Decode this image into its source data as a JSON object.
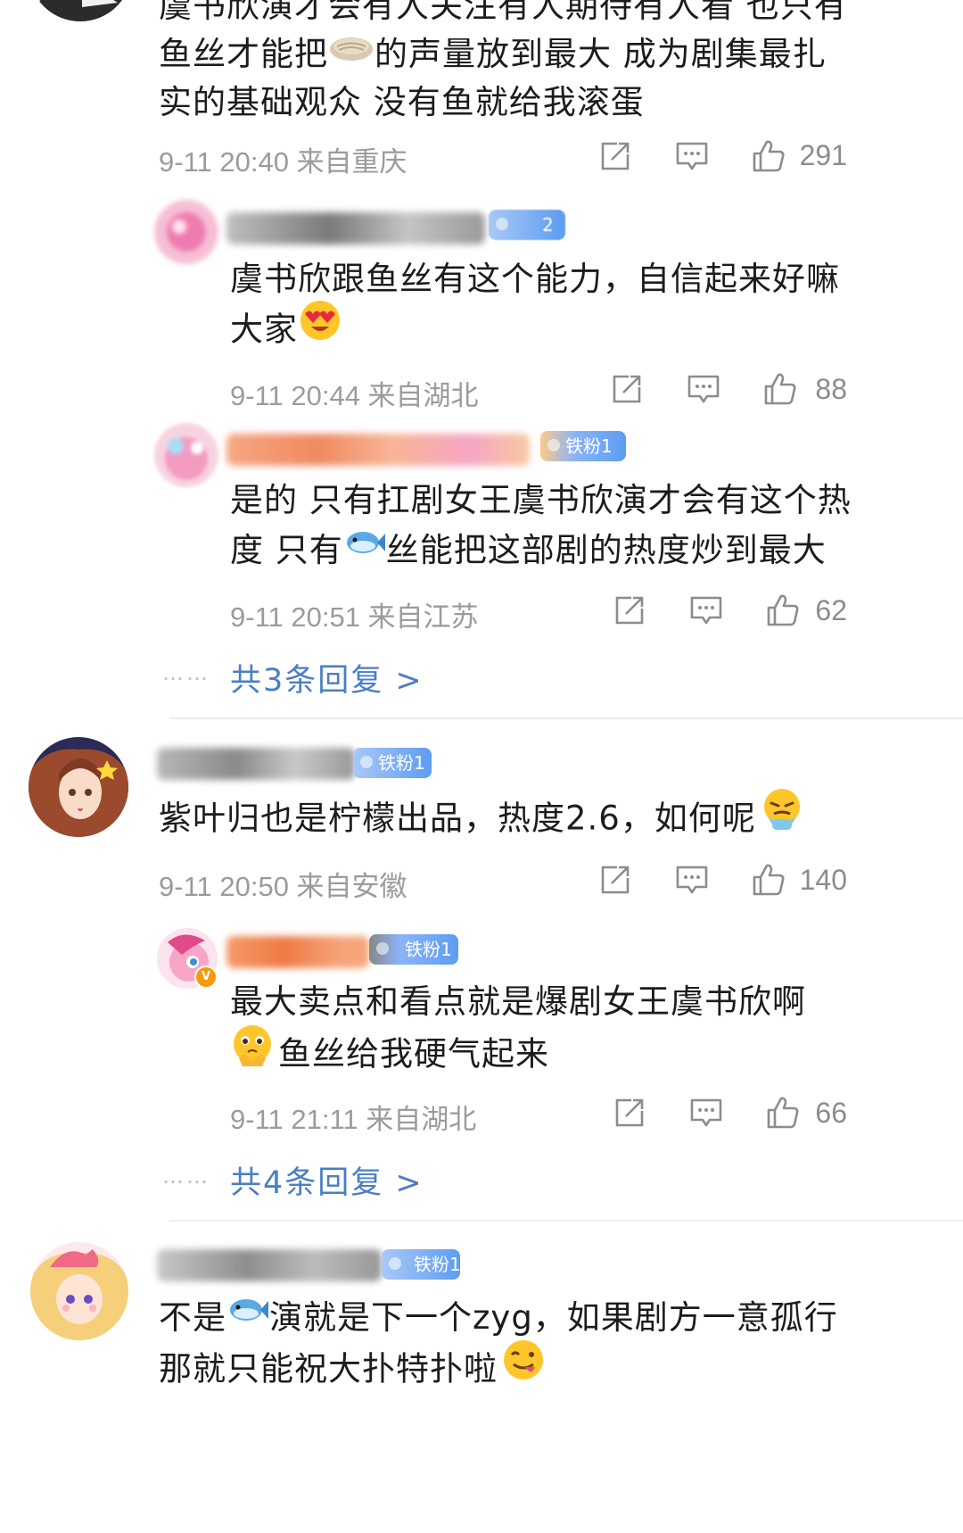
{
  "comments": [
    {
      "lines": [
        "虞书欣演才会有人关注有人期待有人看 也只有",
        "鱼丝才能把",
        "的声量放到最大 成为剧集最扎",
        "实的基础观众 没有鱼就给我滚蛋"
      ],
      "meta": "9-11 20:40 来自重庆",
      "likes": "291",
      "replies": [
        {
          "badge": "2",
          "lines": [
            "虞书欣跟鱼丝有这个能力，自信起来好嘛",
            "大家"
          ],
          "meta": "9-11 20:44 来自湖北",
          "likes": "88"
        },
        {
          "badge": "铁粉1",
          "lines": [
            "是的 只有扛剧女王虞书欣演才会有这个热",
            "度 只有",
            "丝能把这部剧的热度炒到最大"
          ],
          "meta": "9-11 20:51 来自江苏",
          "likes": "62"
        }
      ],
      "more": "共3条回复 >"
    },
    {
      "badge": "铁粉1",
      "lines": [
        "紫叶归也是柠檬出品，热度2.6，如何呢"
      ],
      "meta": "9-11 20:50 来自安徽",
      "likes": "140",
      "replies": [
        {
          "badge": "铁粉1",
          "lines": [
            "最大卖点和看点就是爆剧女王虞书欣啊",
            "鱼丝给我硬气起来"
          ],
          "meta": "9-11 21:11 来自湖北",
          "likes": "66"
        }
      ],
      "more": "共4条回复 >"
    },
    {
      "badge": "铁粉1",
      "lines": [
        "不是",
        "演就是下一个zyg，如果剧方一意孤行",
        "那就只能祝大扑特扑啦"
      ]
    }
  ],
  "more_dots": "……",
  "icons": [
    "share-icon",
    "comment-icon",
    "like-icon"
  ],
  "colors": {
    "link_blue": "#4a7ec4",
    "meta_gray": "#9b9b9b",
    "badge_blue": "#5d9cf2"
  }
}
